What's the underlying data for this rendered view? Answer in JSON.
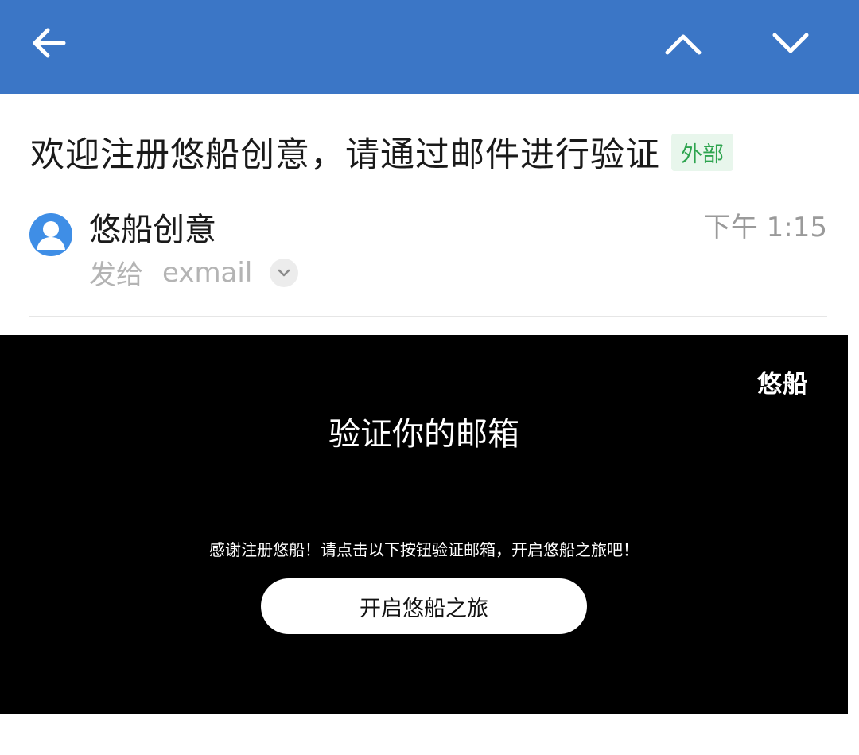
{
  "toolbar": {
    "back_icon": "arrow-left-icon",
    "prev_icon": "chevron-up-icon",
    "next_icon": "chevron-down-icon",
    "color": "#3b76c6"
  },
  "message": {
    "subject": "欢迎注册悠船创意，请通过邮件进行验证",
    "badge": "外部",
    "sender": "悠船创意",
    "time": "下午 1:15",
    "recipient_label": "发给",
    "recipient": "exmail"
  },
  "mail": {
    "logo": "悠船",
    "title": "验证你的邮箱",
    "text": "感谢注册悠船！请点击以下按钮验证邮箱，开启悠船之旅吧！",
    "button": "开启悠船之旅"
  }
}
